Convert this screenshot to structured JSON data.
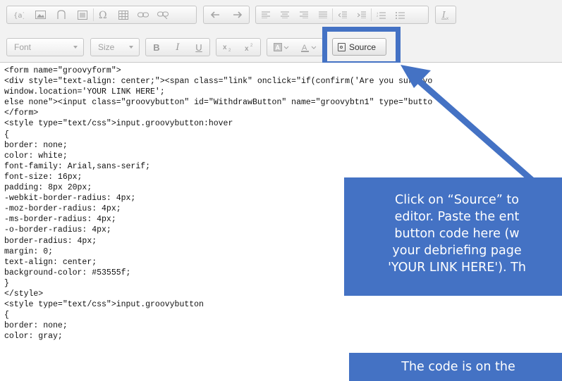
{
  "toolbar": {
    "group1": [
      "variable-icon",
      "image-icon",
      "flash-icon",
      "table-icon",
      "special-char-icon",
      "grid-table-icon",
      "link-icon",
      "unlink-icon"
    ],
    "font_placeholder": "Font",
    "size_placeholder": "Size",
    "bold": "B",
    "italic": "I",
    "underline": "U",
    "source_label": "Source"
  },
  "editor": {
    "code": "<form name=\"groovyform\">\n<div style=\"text-align: center;\"><span class=\"link\" onclick=\"if(confirm('Are you sure yo\nwindow.location='YOUR LINK HERE';\nelse none\"><input class=\"groovybutton\" id=\"WithdrawButton\" name=\"groovybtn1\" type=\"butto\n</form>\n<style type=\"text/css\">input.groovybutton:hover\n{\nborder: none;\ncolor: white;\nfont-family: Arial,sans-serif;\nfont-size: 16px;\npadding: 8px 20px;\n-webkit-border-radius: 4px;\n-moz-border-radius: 4px;\n-ms-border-radius: 4px;\n-o-border-radius: 4px;\nborder-radius: 4px;\nmargin: 0;\ntext-align: center;\nbackground-color: #53555f;\n}\n</style>\n<style type=\"text/css\">input.groovybutton\n{\nborder: none;\ncolor: gray;"
  },
  "callouts": {
    "main_lines": [
      "Click on “Source” to",
      "editor.  Paste the ent",
      "button code here (w",
      "your debriefing page",
      "'YOUR LINK HERE'). Th"
    ],
    "bottom": "The code is on the"
  },
  "colors": {
    "callout_blue": "#4472c4",
    "toolbar_bg": "#f2f2f2"
  }
}
